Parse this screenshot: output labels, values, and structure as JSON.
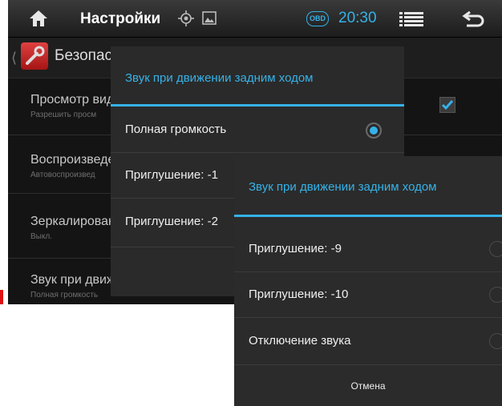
{
  "status_bar": {
    "title": "Настройки",
    "obd": "OBD",
    "time": "20:30",
    "icons": [
      "home-icon",
      "location-icon",
      "image-icon",
      "list-menu-icon",
      "back-arrow-icon"
    ]
  },
  "action_bar": {
    "title": "Безопас"
  },
  "settings_list": [
    {
      "title": "Просмотр вид",
      "subtitle": "Разрешить просм"
    },
    {
      "title": "Воспроизведе",
      "subtitle": "Автовоспроизвед"
    },
    {
      "title": "Зеркалирован",
      "subtitle": "Выкл."
    },
    {
      "title": "Звук при движ",
      "subtitle": "Полная громкость"
    }
  ],
  "dialog_back": {
    "title": "Звук при движении задним ходом",
    "options": [
      "Полная громкость",
      "Приглушение: -1",
      "Приглушение: -2"
    ],
    "selected": "Полная громкость"
  },
  "dialog_front": {
    "title": "Звук при движении задним ходом",
    "options": [
      "Приглушение: -9",
      "Приглушение: -10",
      "Отключение звука"
    ],
    "cancel": "Отмена"
  },
  "colors": {
    "accent": "#35b2e8",
    "background": "#141414",
    "dialog": "#2a2a2a"
  }
}
